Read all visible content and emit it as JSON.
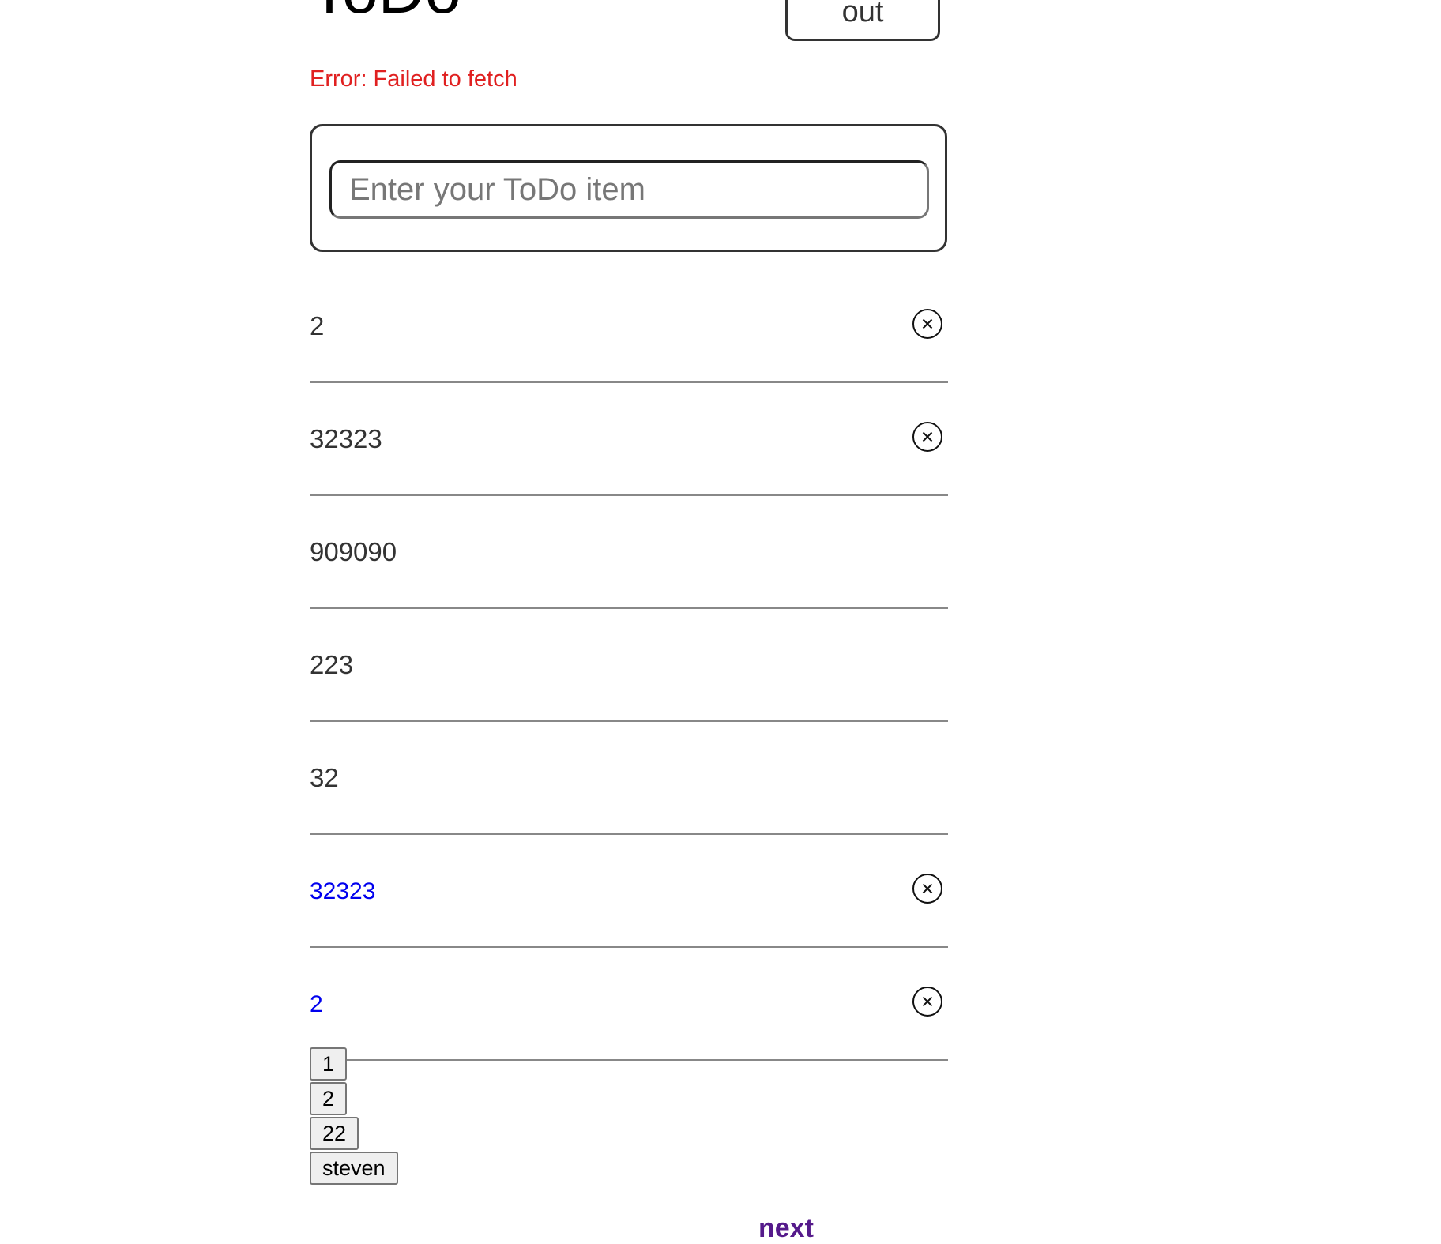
{
  "header": {
    "title": "ToDo",
    "logout_label": "out"
  },
  "error": {
    "message": "Error: Failed to fetch"
  },
  "form": {
    "placeholder": "Enter your ToDo item"
  },
  "todos": [
    {
      "text": "2",
      "completed": false,
      "deletable": true
    },
    {
      "text": "32323",
      "completed": false,
      "deletable": true
    },
    {
      "text": "909090",
      "completed": false,
      "deletable": false
    },
    {
      "text": "223",
      "completed": false,
      "deletable": false
    },
    {
      "text": "32",
      "completed": false,
      "deletable": false
    },
    {
      "text": "32323",
      "completed": true,
      "deletable": true
    },
    {
      "text": "2",
      "completed": true,
      "deletable": true
    }
  ],
  "pagination": {
    "pages": [
      "1",
      "2",
      "22",
      "steven"
    ],
    "next_label": "next"
  },
  "colors": {
    "error": "#e02020",
    "completed_text": "#0000ee",
    "visited_link": "#551a8b",
    "border": "#333333"
  },
  "icons": {
    "delete": "close-circle-icon"
  }
}
